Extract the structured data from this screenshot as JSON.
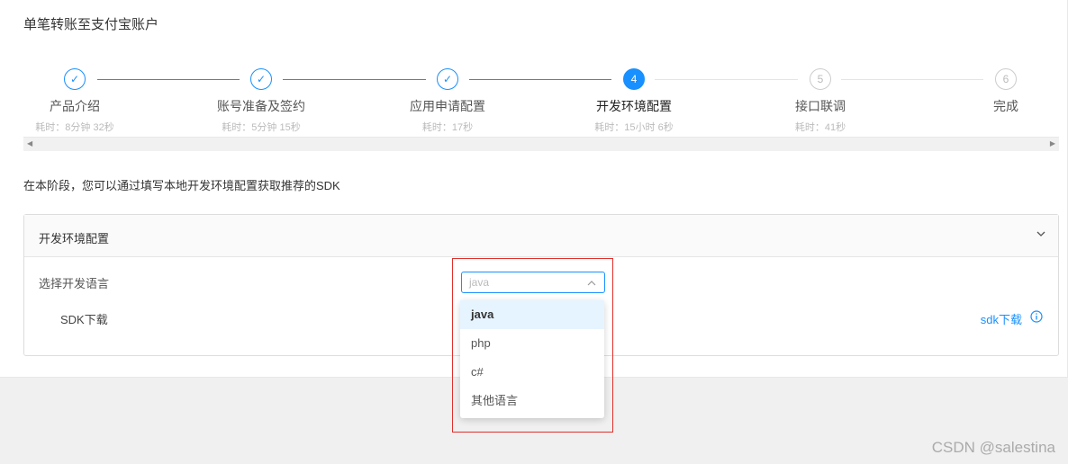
{
  "page": {
    "title": "单笔转账至支付宝账户"
  },
  "steps": [
    {
      "index": "✓",
      "label": "产品介绍",
      "time": "耗时：8分钟 32秒",
      "state": "done"
    },
    {
      "index": "✓",
      "label": "账号准备及签约",
      "time": "耗时：5分钟 15秒",
      "state": "done"
    },
    {
      "index": "✓",
      "label": "应用申请配置",
      "time": "耗时：17秒",
      "state": "done"
    },
    {
      "index": "4",
      "label": "开发环境配置",
      "time": "耗时：15小时 6秒",
      "state": "active"
    },
    {
      "index": "5",
      "label": "接口联调",
      "time": "耗时：41秒",
      "state": "todo"
    },
    {
      "index": "6",
      "label": "完成",
      "time": "",
      "state": "todo"
    }
  ],
  "scrollbar": {
    "left_arrow": "◀",
    "right_arrow": "▶"
  },
  "description": "在本阶段，您可以通过填写本地开发环境配置获取推荐的SDK",
  "panel": {
    "title": "开发环境配置",
    "language_label": "选择开发语言",
    "language_select": {
      "placeholder": "java"
    },
    "sdk_label": "SDK下载",
    "sdk_link": "sdk下载"
  },
  "dropdown": {
    "options": [
      "java",
      "php",
      "c#",
      "其他语言"
    ],
    "selected_index": 0
  },
  "colors": {
    "accent": "#1890ff",
    "highlight": "#e0302b"
  },
  "watermark": "CSDN @salestina"
}
